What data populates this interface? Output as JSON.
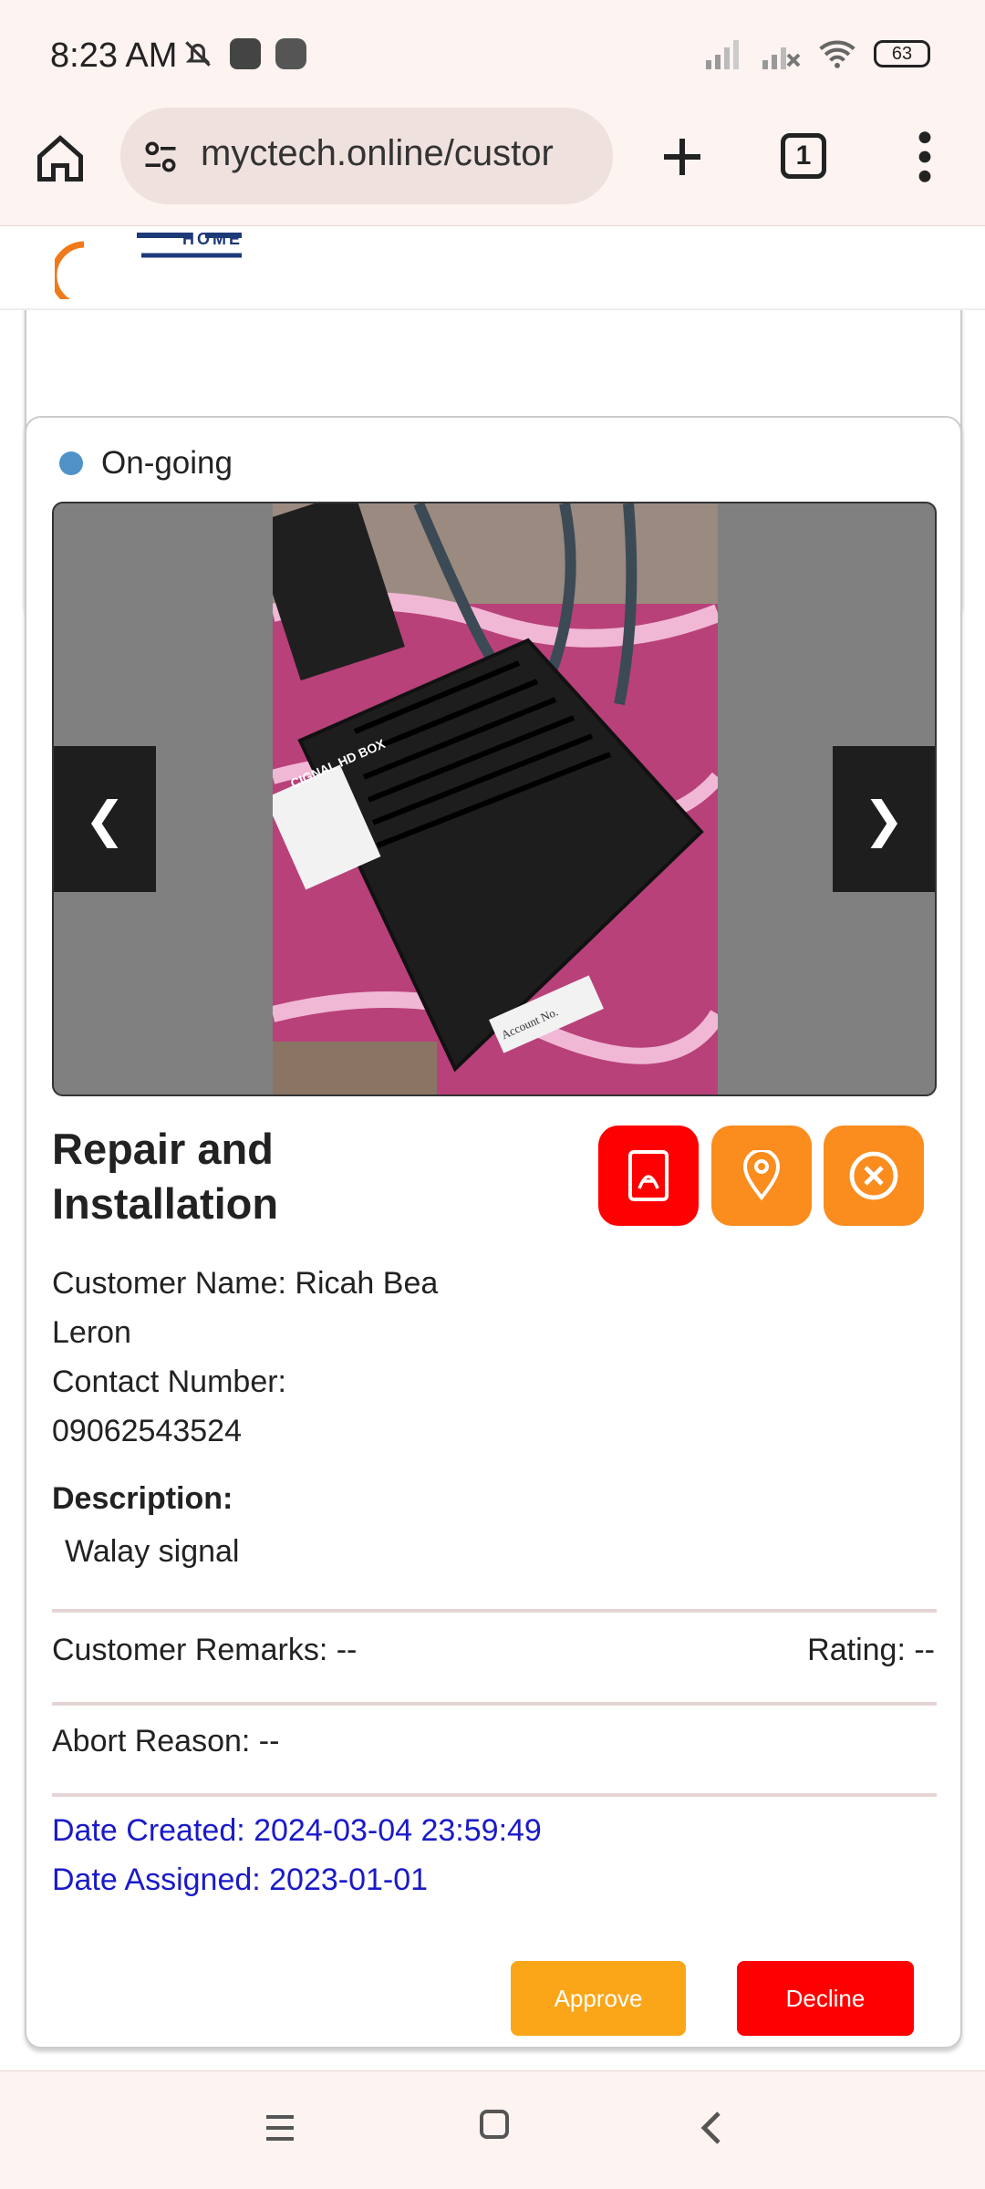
{
  "status_bar": {
    "time": "8:23 AM",
    "battery": "63",
    "icons": [
      "bell-off-icon",
      "bag-icon",
      "messenger-icon",
      "signal-icon",
      "signal-x-icon",
      "wifi-icon",
      "battery-icon"
    ]
  },
  "browser": {
    "url": "myctech.online/custor",
    "tab_count": "1"
  },
  "job": {
    "status": "On-going",
    "status_color": "#4e92c8",
    "title": "Repair and Installation",
    "customer_name": "Customer Name: Ricah Bea Leron",
    "contact_number": "Contact Number: 09062543524",
    "description_label": "Description:",
    "description": "Walay signal",
    "customer_remarks": "Customer Remarks: --",
    "rating": "Rating: --",
    "abort_reason": "Abort Reason: --",
    "date_created": "Date Created: 2024-03-04 23:59:49",
    "date_assigned": "Date Assigned: 2023-01-01"
  },
  "slider": {
    "prev_label": "❮",
    "next_label": "❯",
    "photo_label": "CIGNAL HD BOX",
    "photo_sticker": "Account No."
  },
  "actions": {
    "approve_label": "Approve",
    "decline_label": "Decline",
    "pdf_color": "#ff0000",
    "accent_color": "#fb8c1e",
    "approve_color": "#fba619",
    "decline_color": "#ff0000"
  }
}
